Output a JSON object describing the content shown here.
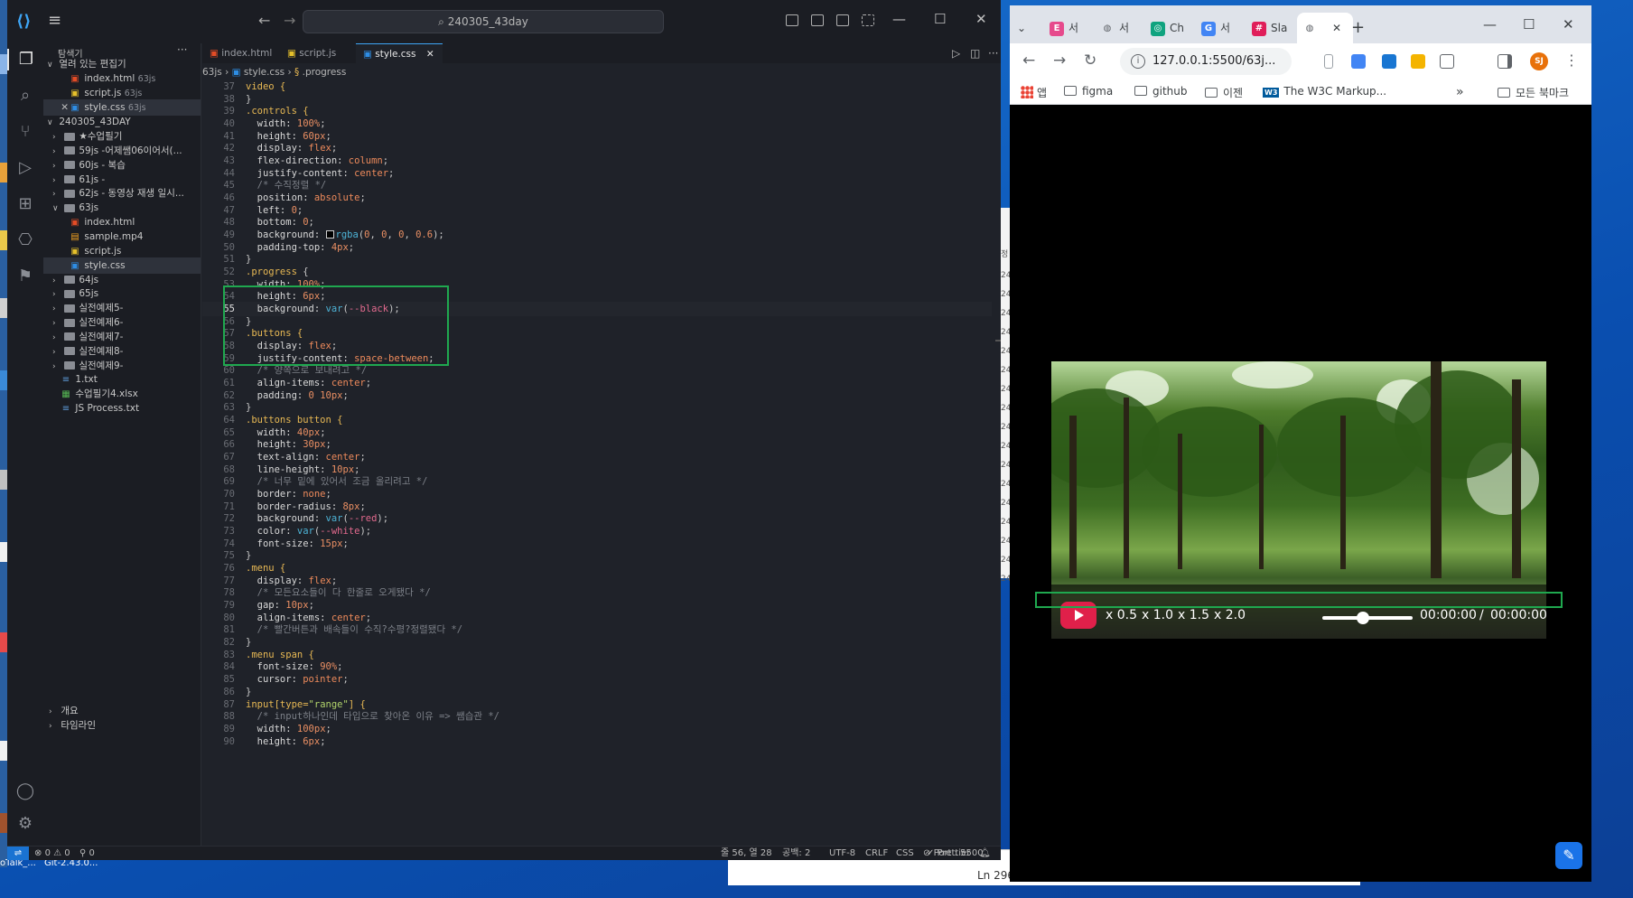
{
  "vscode": {
    "search_text": "240305_43day",
    "sidebar": {
      "title": "탐색기",
      "open_editors_label": "열려 있는 편집기",
      "open_editors": [
        {
          "name": "index.html",
          "hint": "63js"
        },
        {
          "name": "script.js",
          "hint": "63js"
        },
        {
          "name": "style.css",
          "hint": "63js"
        }
      ],
      "root_label": "240305_43DAY",
      "tree": [
        {
          "name": "★수업필기",
          "type": "folder"
        },
        {
          "name": "59js -어제쌤06이어서(...",
          "type": "folder"
        },
        {
          "name": "60js - 복습",
          "type": "folder"
        },
        {
          "name": "61js -",
          "type": "folder"
        },
        {
          "name": "62js - 동영상 재생 일시...",
          "type": "folder"
        },
        {
          "name": "63js",
          "type": "folder-open"
        },
        {
          "name": "index.html",
          "type": "html"
        },
        {
          "name": "sample.mp4",
          "type": "mp4"
        },
        {
          "name": "script.js",
          "type": "js"
        },
        {
          "name": "style.css",
          "type": "css"
        },
        {
          "name": "64js",
          "type": "folder"
        },
        {
          "name": "65js",
          "type": "folder"
        },
        {
          "name": "실전예제5-",
          "type": "folder"
        },
        {
          "name": "실전예제6-",
          "type": "folder"
        },
        {
          "name": "실전예제7-",
          "type": "folder"
        },
        {
          "name": "실전예제8-",
          "type": "folder"
        },
        {
          "name": "실전예제9-",
          "type": "folder"
        },
        {
          "name": "1.txt",
          "type": "txt"
        },
        {
          "name": "수업필기4.xlsx",
          "type": "xlsx"
        },
        {
          "name": "JS Process.txt",
          "type": "txt"
        }
      ],
      "outline_label": "개요",
      "timeline_label": "타임라인"
    },
    "tabs": [
      "index.html",
      "script.js",
      "style.css"
    ],
    "breadcrumb": [
      "63js",
      "style.css",
      ".progress"
    ],
    "code": [
      {
        "n": 37,
        "t": [
          [
            "c-sel",
            "video {"
          ]
        ]
      },
      {
        "n": 38,
        "t": [
          [
            "c-pun",
            "}"
          ]
        ]
      },
      {
        "n": 39,
        "t": [
          [
            "c-sel",
            ".controls {"
          ]
        ]
      },
      {
        "n": 40,
        "t": [
          [
            "c-prop",
            "  width: "
          ],
          [
            "c-num",
            "100%"
          ],
          [
            "c-pun",
            ";"
          ]
        ]
      },
      {
        "n": 41,
        "t": [
          [
            "c-prop",
            "  height: "
          ],
          [
            "c-num",
            "60px"
          ],
          [
            "c-pun",
            ";"
          ]
        ]
      },
      {
        "n": 42,
        "t": [
          [
            "c-prop",
            "  display: "
          ],
          [
            "c-val",
            "flex"
          ],
          [
            "c-pun",
            ";"
          ]
        ]
      },
      {
        "n": 43,
        "t": [
          [
            "c-prop",
            "  flex-direction: "
          ],
          [
            "c-val",
            "column"
          ],
          [
            "c-pun",
            ";"
          ]
        ]
      },
      {
        "n": 44,
        "t": [
          [
            "c-prop",
            "  justify-content: "
          ],
          [
            "c-val",
            "center"
          ],
          [
            "c-pun",
            ";"
          ]
        ]
      },
      {
        "n": 45,
        "t": [
          [
            "c-cmt",
            "  /* 수직정렬 */"
          ]
        ]
      },
      {
        "n": 46,
        "t": [
          [
            "c-prop",
            "  position: "
          ],
          [
            "c-val",
            "absolute"
          ],
          [
            "c-pun",
            ";"
          ]
        ]
      },
      {
        "n": 47,
        "t": [
          [
            "c-prop",
            "  left: "
          ],
          [
            "c-num",
            "0"
          ],
          [
            "c-pun",
            ";"
          ]
        ]
      },
      {
        "n": 48,
        "t": [
          [
            "c-prop",
            "  bottom: "
          ],
          [
            "c-num",
            "0"
          ],
          [
            "c-pun",
            ";"
          ]
        ]
      },
      {
        "n": 49,
        "t": [
          [
            "c-prop",
            "  background: "
          ],
          [
            "swatch",
            ""
          ],
          [
            "c-fn",
            "rgba"
          ],
          [
            "c-pun",
            "("
          ],
          [
            "c-num",
            "0"
          ],
          [
            "c-pun",
            ", "
          ],
          [
            "c-num",
            "0"
          ],
          [
            "c-pun",
            ", "
          ],
          [
            "c-num",
            "0"
          ],
          [
            "c-pun",
            ", "
          ],
          [
            "c-num",
            "0.6"
          ],
          [
            "c-pun",
            ");"
          ]
        ]
      },
      {
        "n": 50,
        "t": [
          [
            "c-prop",
            "  padding-top: "
          ],
          [
            "c-num",
            "4px"
          ],
          [
            "c-pun",
            ";"
          ]
        ]
      },
      {
        "n": 51,
        "t": [
          [
            "c-pun",
            "}"
          ]
        ]
      },
      {
        "n": 52,
        "t": [
          [
            "c-sel",
            ".progress "
          ],
          [
            "c-pun",
            "{"
          ]
        ]
      },
      {
        "n": 53,
        "t": [
          [
            "c-prop",
            "  width: "
          ],
          [
            "c-num",
            "100%"
          ],
          [
            "c-pun",
            ";"
          ]
        ]
      },
      {
        "n": 54,
        "t": [
          [
            "c-prop",
            "  height: "
          ],
          [
            "c-num",
            "6px"
          ],
          [
            "c-pun",
            ";"
          ]
        ]
      },
      {
        "n": 55,
        "t": [
          [
            "c-prop",
            "  background: "
          ],
          [
            "c-fn",
            "var"
          ],
          [
            "c-pun",
            "("
          ],
          [
            "c-var",
            "--black"
          ],
          [
            "c-pun",
            ");"
          ]
        ],
        "cur": true
      },
      {
        "n": 56,
        "t": [
          [
            "c-pun",
            "}"
          ]
        ]
      },
      {
        "n": 57,
        "t": [
          [
            "c-sel",
            ".buttons {"
          ]
        ]
      },
      {
        "n": 58,
        "t": [
          [
            "c-prop",
            "  display: "
          ],
          [
            "c-val",
            "flex"
          ],
          [
            "c-pun",
            ";"
          ]
        ]
      },
      {
        "n": 59,
        "t": [
          [
            "c-prop",
            "  justify-content: "
          ],
          [
            "c-val",
            "space-between"
          ],
          [
            "c-pun",
            ";"
          ]
        ]
      },
      {
        "n": 60,
        "t": [
          [
            "c-cmt",
            "  /* 양쪽으로 보내려고 */"
          ]
        ]
      },
      {
        "n": 61,
        "t": [
          [
            "c-prop",
            "  align-items: "
          ],
          [
            "c-val",
            "center"
          ],
          [
            "c-pun",
            ";"
          ]
        ]
      },
      {
        "n": 62,
        "t": [
          [
            "c-prop",
            "  padding: "
          ],
          [
            "c-num",
            "0 10px"
          ],
          [
            "c-pun",
            ";"
          ]
        ]
      },
      {
        "n": 63,
        "t": [
          [
            "c-pun",
            "}"
          ]
        ]
      },
      {
        "n": 64,
        "t": [
          [
            "c-sel",
            ".buttons button {"
          ]
        ]
      },
      {
        "n": 65,
        "t": [
          [
            "c-prop",
            "  width: "
          ],
          [
            "c-num",
            "40px"
          ],
          [
            "c-pun",
            ";"
          ]
        ]
      },
      {
        "n": 66,
        "t": [
          [
            "c-prop",
            "  height: "
          ],
          [
            "c-num",
            "30px"
          ],
          [
            "c-pun",
            ";"
          ]
        ]
      },
      {
        "n": 67,
        "t": [
          [
            "c-prop",
            "  text-align: "
          ],
          [
            "c-val",
            "center"
          ],
          [
            "c-pun",
            ";"
          ]
        ]
      },
      {
        "n": 68,
        "t": [
          [
            "c-prop",
            "  line-height: "
          ],
          [
            "c-num",
            "10px"
          ],
          [
            "c-pun",
            ";"
          ]
        ]
      },
      {
        "n": 69,
        "t": [
          [
            "c-cmt",
            "  /* 너무 밑에 있어서 조금 올리려고 */"
          ]
        ]
      },
      {
        "n": 70,
        "t": [
          [
            "c-prop",
            "  border: "
          ],
          [
            "c-val",
            "none"
          ],
          [
            "c-pun",
            ";"
          ]
        ]
      },
      {
        "n": 71,
        "t": [
          [
            "c-prop",
            "  border-radius: "
          ],
          [
            "c-num",
            "8px"
          ],
          [
            "c-pun",
            ";"
          ]
        ]
      },
      {
        "n": 72,
        "t": [
          [
            "c-prop",
            "  background: "
          ],
          [
            "c-fn",
            "var"
          ],
          [
            "c-pun",
            "("
          ],
          [
            "c-var",
            "--red"
          ],
          [
            "c-pun",
            ");"
          ]
        ]
      },
      {
        "n": 73,
        "t": [
          [
            "c-prop",
            "  color: "
          ],
          [
            "c-fn",
            "var"
          ],
          [
            "c-pun",
            "("
          ],
          [
            "c-var",
            "--white"
          ],
          [
            "c-pun",
            ");"
          ]
        ]
      },
      {
        "n": 74,
        "t": [
          [
            "c-prop",
            "  font-size: "
          ],
          [
            "c-num",
            "15px"
          ],
          [
            "c-pun",
            ";"
          ]
        ]
      },
      {
        "n": 75,
        "t": [
          [
            "c-pun",
            "}"
          ]
        ]
      },
      {
        "n": 76,
        "t": [
          [
            "c-sel",
            ".menu {"
          ]
        ]
      },
      {
        "n": 77,
        "t": [
          [
            "c-prop",
            "  display: "
          ],
          [
            "c-val",
            "flex"
          ],
          [
            "c-pun",
            ";"
          ]
        ]
      },
      {
        "n": 78,
        "t": [
          [
            "c-cmt",
            "  /* 모든요소들이 다 한줄로 오게됐다 */"
          ]
        ]
      },
      {
        "n": 79,
        "t": [
          [
            "c-prop",
            "  gap: "
          ],
          [
            "c-num",
            "10px"
          ],
          [
            "c-pun",
            ";"
          ]
        ]
      },
      {
        "n": 80,
        "t": [
          [
            "c-prop",
            "  align-items: "
          ],
          [
            "c-val",
            "center"
          ],
          [
            "c-pun",
            ";"
          ]
        ]
      },
      {
        "n": 81,
        "t": [
          [
            "c-cmt",
            "  /* 빨간버튼과 배속들이 수직?수평?정렬됐다 */"
          ]
        ]
      },
      {
        "n": 82,
        "t": [
          [
            "c-pun",
            "}"
          ]
        ]
      },
      {
        "n": 83,
        "t": [
          [
            "c-sel",
            ".menu span {"
          ]
        ]
      },
      {
        "n": 84,
        "t": [
          [
            "c-prop",
            "  font-size: "
          ],
          [
            "c-num",
            "90%"
          ],
          [
            "c-pun",
            ";"
          ]
        ]
      },
      {
        "n": 85,
        "t": [
          [
            "c-prop",
            "  cursor: "
          ],
          [
            "c-val",
            "pointer"
          ],
          [
            "c-pun",
            ";"
          ]
        ]
      },
      {
        "n": 86,
        "t": [
          [
            "c-pun",
            "}"
          ]
        ]
      },
      {
        "n": 87,
        "t": [
          [
            "c-sel",
            "input[type="
          ],
          [
            "c-str",
            "\"range\""
          ],
          [
            "c-sel",
            "] {"
          ]
        ]
      },
      {
        "n": 88,
        "t": [
          [
            "c-cmt",
            "  /* input하나인데 타입으로 찾아온 이유 => 쌤습관 */"
          ]
        ]
      },
      {
        "n": 89,
        "t": [
          [
            "c-prop",
            "  width: "
          ],
          [
            "c-num",
            "100px"
          ],
          [
            "c-pun",
            ";"
          ]
        ]
      },
      {
        "n": 90,
        "t": [
          [
            "c-prop",
            "  height: "
          ],
          [
            "c-num",
            "6px"
          ],
          [
            "c-pun",
            ";"
          ]
        ]
      }
    ],
    "status": {
      "errors": "0",
      "warnings": "0",
      "ports": "0",
      "position": "줄 56, 열 28",
      "spaces": "공백: 2",
      "encoding": "UTF-8",
      "eol": "CRLF",
      "language": "CSS",
      "port": "Port : 5500",
      "formatter": "Prettier"
    }
  },
  "chrome": {
    "tabs": [
      {
        "label": "서",
        "icon": "E",
        "color": "#e64a8c"
      },
      {
        "label": "서",
        "icon": "◍",
        "color": "#5f6368"
      },
      {
        "label": "Ch",
        "icon": "◎",
        "color": "#10a37f"
      },
      {
        "label": "서",
        "icon": "G",
        "color": "#4285f4"
      },
      {
        "label": "Sla",
        "icon": "#",
        "color": "#e01e5a"
      },
      {
        "label": "",
        "icon": "◍",
        "color": "#5f6368"
      }
    ],
    "url": "127.0.0.1:5500/63j...",
    "bookmarks": [
      "앱",
      "figma",
      "github",
      "이젠",
      "The W3C Markup...",
      "모든 북마크"
    ],
    "w3c_badge": "W3",
    "avatar": "SJ",
    "player": {
      "speeds": [
        "x 0.5",
        "x 1.0",
        "x 1.5",
        "x 2.0"
      ],
      "current_time": "00:00:00",
      "separator": "/",
      "duration": "00:00:00",
      "volume_fraction": 0.45
    }
  },
  "behind": {
    "ln_text": "Ln 296",
    "side_label": "정",
    "rows": [
      "24",
      "24",
      "24",
      "24",
      "24",
      "24",
      "24",
      "24",
      "24",
      "24",
      "24",
      "24",
      "24",
      "24",
      "24",
      "24",
      "24"
    ]
  },
  "desktop": {
    "taskbar_text": [
      "oTalk_...",
      "Git-2.43.0..."
    ]
  },
  "colors": {
    "accent_green": "#1fa84f",
    "play_red": "#e0204a",
    "vscode_bg": "#1f2229"
  }
}
